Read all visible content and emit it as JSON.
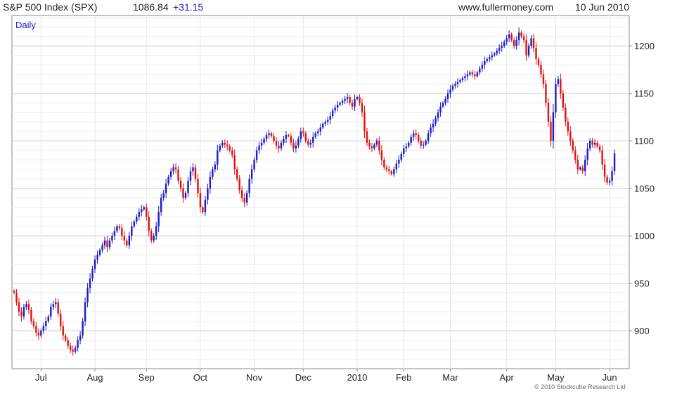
{
  "header": {
    "title": "S&P 500 Index (SPX)",
    "price": "1086.84",
    "change": "+31.15",
    "website": "www.fullermoney.com",
    "date": "10 Jun 2010"
  },
  "copyright": "© 2010 Stockcube Research Ltd",
  "colors": {
    "up": "#1a1acc",
    "down": "#e01010",
    "grid": "#d9d9d9",
    "frame": "#888888"
  },
  "chart_data": {
    "type": "candlestick",
    "period_label": "Daily",
    "ylim": [
      860,
      1232
    ],
    "y_ticks": [
      900,
      950,
      1000,
      1050,
      1100,
      1150,
      1200
    ],
    "x_tick_labels": [
      "Jul",
      "Aug",
      "Sep",
      "Oct",
      "Nov",
      "Dec",
      "2010",
      "Feb",
      "Mar",
      "Apr",
      "May",
      "Jun"
    ],
    "x_tick_days": [
      11,
      33,
      54,
      76,
      98,
      118,
      140,
      159,
      178,
      201,
      221,
      243
    ],
    "total_days": 250,
    "grid": true,
    "close_series": [
      940,
      930,
      920,
      915,
      925,
      928,
      922,
      910,
      905,
      898,
      895,
      900,
      905,
      910,
      915,
      925,
      928,
      930,
      918,
      905,
      895,
      890,
      884,
      880,
      878,
      882,
      890,
      895,
      910,
      930,
      945,
      955,
      965,
      975,
      980,
      985,
      990,
      995,
      988,
      995,
      1000,
      1005,
      1010,
      1008,
      1000,
      995,
      990,
      1000,
      1010,
      1015,
      1020,
      1025,
      1028,
      1030,
      1020,
      1005,
      995,
      1000,
      1010,
      1025,
      1040,
      1045,
      1055,
      1062,
      1068,
      1072,
      1070,
      1058,
      1050,
      1040,
      1045,
      1058,
      1068,
      1072,
      1060,
      1045,
      1030,
      1025,
      1038,
      1050,
      1062,
      1070,
      1075,
      1090,
      1095,
      1098,
      1096,
      1094,
      1090,
      1085,
      1070,
      1060,
      1048,
      1040,
      1035,
      1045,
      1060,
      1070,
      1080,
      1090,
      1095,
      1098,
      1102,
      1106,
      1108,
      1105,
      1100,
      1095,
      1092,
      1098,
      1102,
      1106,
      1105,
      1098,
      1092,
      1095,
      1102,
      1110,
      1108,
      1100,
      1096,
      1098,
      1104,
      1108,
      1110,
      1114,
      1118,
      1120,
      1122,
      1126,
      1132,
      1135,
      1138,
      1140,
      1142,
      1144,
      1146,
      1140,
      1136,
      1144,
      1146,
      1140,
      1130,
      1110,
      1098,
      1094,
      1092,
      1096,
      1100,
      1090,
      1080,
      1072,
      1070,
      1068,
      1065,
      1070,
      1076,
      1080,
      1086,
      1092,
      1094,
      1098,
      1104,
      1108,
      1106,
      1100,
      1095,
      1096,
      1100,
      1108,
      1114,
      1118,
      1124,
      1130,
      1136,
      1140,
      1144,
      1150,
      1154,
      1158,
      1160,
      1162,
      1164,
      1166,
      1168,
      1170,
      1172,
      1170,
      1168,
      1172,
      1176,
      1180,
      1184,
      1186,
      1188,
      1190,
      1192,
      1195,
      1198,
      1200,
      1204,
      1208,
      1212,
      1206,
      1200,
      1206,
      1214,
      1210,
      1206,
      1190,
      1200,
      1208,
      1198,
      1186,
      1180,
      1170,
      1160,
      1140,
      1120,
      1100,
      1130,
      1160,
      1165,
      1150,
      1135,
      1120,
      1110,
      1100,
      1090,
      1080,
      1070,
      1072,
      1068,
      1080,
      1092,
      1100,
      1096,
      1098,
      1094,
      1090,
      1075,
      1062,
      1056,
      1058,
      1068,
      1086.84
    ]
  }
}
